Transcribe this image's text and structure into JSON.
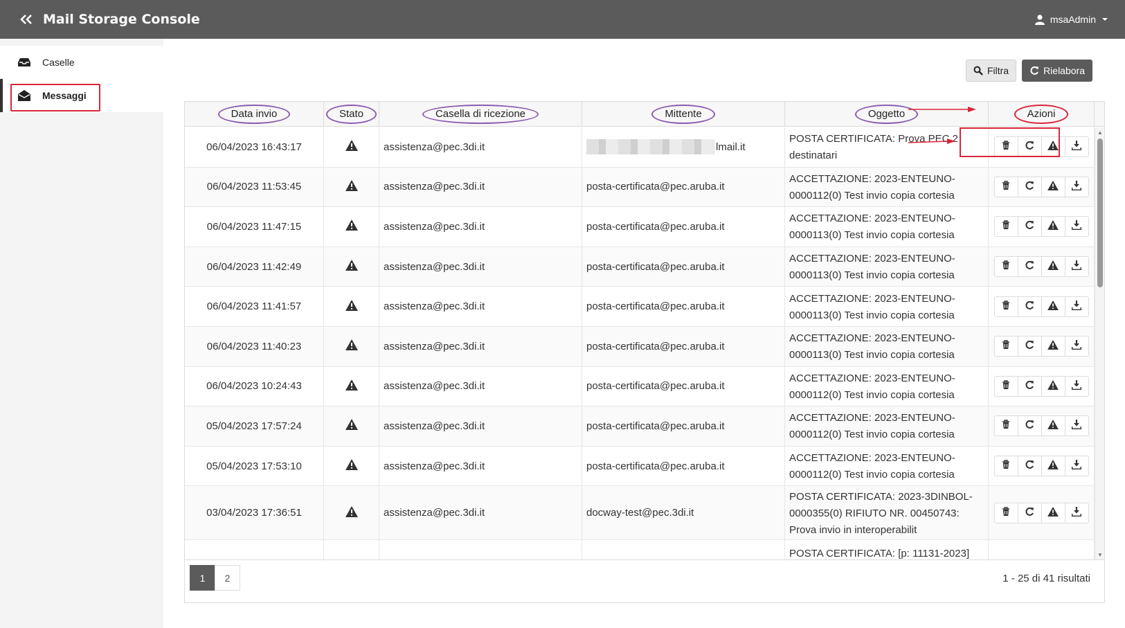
{
  "app": {
    "title": "Mail Storage Console",
    "user": "msaAdmin"
  },
  "sidebar": {
    "items": [
      {
        "label": "Caselle",
        "icon": "inbox-icon"
      },
      {
        "label": "Messaggi",
        "icon": "envelope-open-icon",
        "active": true
      }
    ]
  },
  "toolbar": {
    "filter_label": "Filtra",
    "reprocess_label": "Rielabora"
  },
  "table": {
    "headers": [
      "Data invio",
      "Stato",
      "Casella di ricezione",
      "Mittente",
      "Oggetto",
      "Azioni"
    ],
    "rows": [
      {
        "date": "06/04/2023 16:43:17",
        "casella": "assistenza@pec.3di.it",
        "mittente": "lmail.it",
        "oggetto1": "POSTA CERTIFICATA: Prova PEC 2",
        "oggetto2": "destinatari"
      },
      {
        "date": "06/04/2023 11:53:45",
        "casella": "assistenza@pec.3di.it",
        "mittente": "posta-certificata@pec.aruba.it",
        "oggetto1": "ACCETTAZIONE: 2023-ENTEUNO-",
        "oggetto2": "0000112(0) Test invio copia cortesia"
      },
      {
        "date": "06/04/2023 11:47:15",
        "casella": "assistenza@pec.3di.it",
        "mittente": "posta-certificata@pec.aruba.it",
        "oggetto1": "ACCETTAZIONE: 2023-ENTEUNO-",
        "oggetto2": "0000113(0) Test invio copia cortesia"
      },
      {
        "date": "06/04/2023 11:42:49",
        "casella": "assistenza@pec.3di.it",
        "mittente": "posta-certificata@pec.aruba.it",
        "oggetto1": "ACCETTAZIONE: 2023-ENTEUNO-",
        "oggetto2": "0000113(0) Test invio copia cortesia"
      },
      {
        "date": "06/04/2023 11:41:57",
        "casella": "assistenza@pec.3di.it",
        "mittente": "posta-certificata@pec.aruba.it",
        "oggetto1": "ACCETTAZIONE: 2023-ENTEUNO-",
        "oggetto2": "0000113(0) Test invio copia cortesia"
      },
      {
        "date": "06/04/2023 11:40:23",
        "casella": "assistenza@pec.3di.it",
        "mittente": "posta-certificata@pec.aruba.it",
        "oggetto1": "ACCETTAZIONE: 2023-ENTEUNO-",
        "oggetto2": "0000113(0) Test invio copia cortesia"
      },
      {
        "date": "06/04/2023 10:24:43",
        "casella": "assistenza@pec.3di.it",
        "mittente": "posta-certificata@pec.aruba.it",
        "oggetto1": "ACCETTAZIONE: 2023-ENTEUNO-",
        "oggetto2": "0000112(0) Test invio copia cortesia"
      },
      {
        "date": "05/04/2023 17:57:24",
        "casella": "assistenza@pec.3di.it",
        "mittente": "posta-certificata@pec.aruba.it",
        "oggetto1": "ACCETTAZIONE: 2023-ENTEUNO-",
        "oggetto2": "0000112(0) Test invio copia cortesia"
      },
      {
        "date": "05/04/2023 17:53:10",
        "casella": "assistenza@pec.3di.it",
        "mittente": "posta-certificata@pec.aruba.it",
        "oggetto1": "ACCETTAZIONE: 2023-ENTEUNO-",
        "oggetto2": "0000112(0) Test invio copia cortesia"
      },
      {
        "date": "03/04/2023 17:36:51",
        "casella": "assistenza@pec.3di.it",
        "mittente": "docway-test@pec.3di.it",
        "oggetto1": "POSTA CERTIFICATA: 2023-3DINBOL-",
        "oggetto2": "0000355(0) RIFIUTO NR. 00450743:",
        "oggetto3": "Prova invio in interoperabilit"
      },
      {
        "date": "",
        "casella": "",
        "mittente": "",
        "oggetto1": "POSTA CERTIFICATA: [p: 11131-2023]",
        "oggetto2": ""
      }
    ],
    "row_actions": [
      "trash-icon",
      "refresh-icon",
      "warning-icon",
      "download-icon"
    ],
    "status_icon": "warning-icon"
  },
  "pagination": {
    "pages": [
      "1",
      "2"
    ],
    "current": "1",
    "results": "1 - 25 di 41 risultati"
  },
  "colors": {
    "topbar": "#5b5b5b",
    "annotation_red": "#d9263a",
    "annotation_purple": "#8a5cb2"
  }
}
